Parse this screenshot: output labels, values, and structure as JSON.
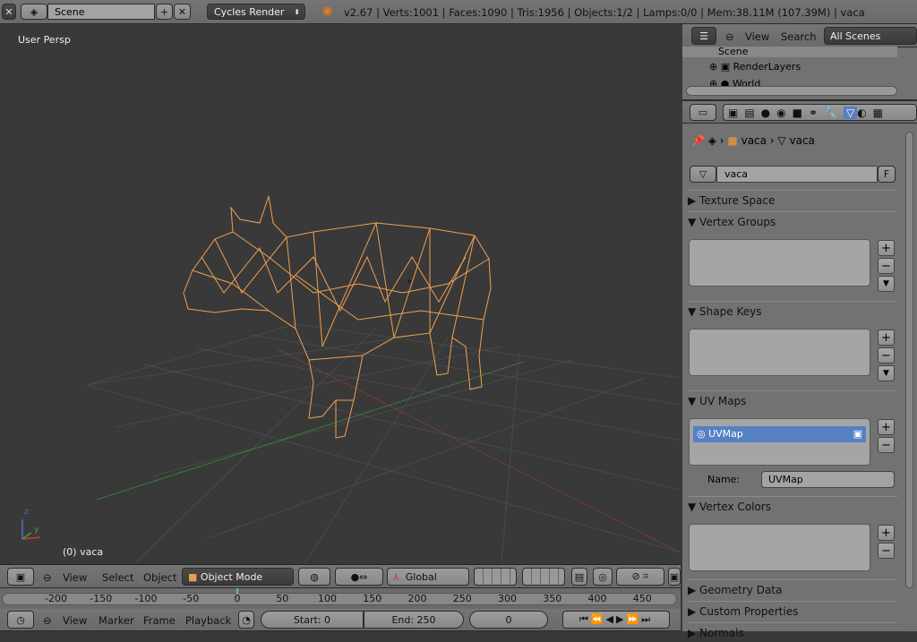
{
  "top": {
    "scene": "Scene",
    "engine": "Cycles Render",
    "stats": "v2.67 | Verts:1001 | Faces:1090 | Tris:1956 | Objects:1/2 | Lamps:0/0 | Mem:38.11M (107.39M) | vaca"
  },
  "viewport": {
    "label": "User Persp",
    "object": "(0) vaca",
    "axis_x": "x",
    "axis_y": "y",
    "axis_z": "z"
  },
  "view3d_header": {
    "view": "View",
    "select": "Select",
    "object": "Object",
    "mode": "Object Mode",
    "orientation": "Global"
  },
  "timeline": {
    "ticks": [
      "-200",
      "-150",
      "-100",
      "-50",
      "0",
      "50",
      "100",
      "150",
      "200",
      "250",
      "300",
      "350",
      "400",
      "450"
    ],
    "view": "View",
    "marker": "Marker",
    "frame": "Frame",
    "playback": "Playback",
    "start": "Start: 0",
    "end": "End: 250",
    "current": "0"
  },
  "outliner": {
    "view": "View",
    "search": "Search",
    "filter": "All Scenes",
    "items": [
      "Scene",
      "RenderLayers",
      "World"
    ]
  },
  "properties": {
    "breadcrumb": [
      "vaca",
      "vaca"
    ],
    "mesh_name": "vaca",
    "fake_user": "F",
    "panels": {
      "texture_space": "Texture Space",
      "vertex_groups": "Vertex Groups",
      "shape_keys": "Shape Keys",
      "uv_maps": "UV Maps",
      "vertex_colors": "Vertex Colors",
      "geometry_data": "Geometry Data",
      "custom_properties": "Custom Properties",
      "normals": "Normals"
    },
    "uv_map_item": "UVMap",
    "name_label": "Name:",
    "name_value": "UVMap"
  },
  "colors": {
    "wire": "#f0a050",
    "selected": "#5680c2",
    "bg": "#393939"
  }
}
